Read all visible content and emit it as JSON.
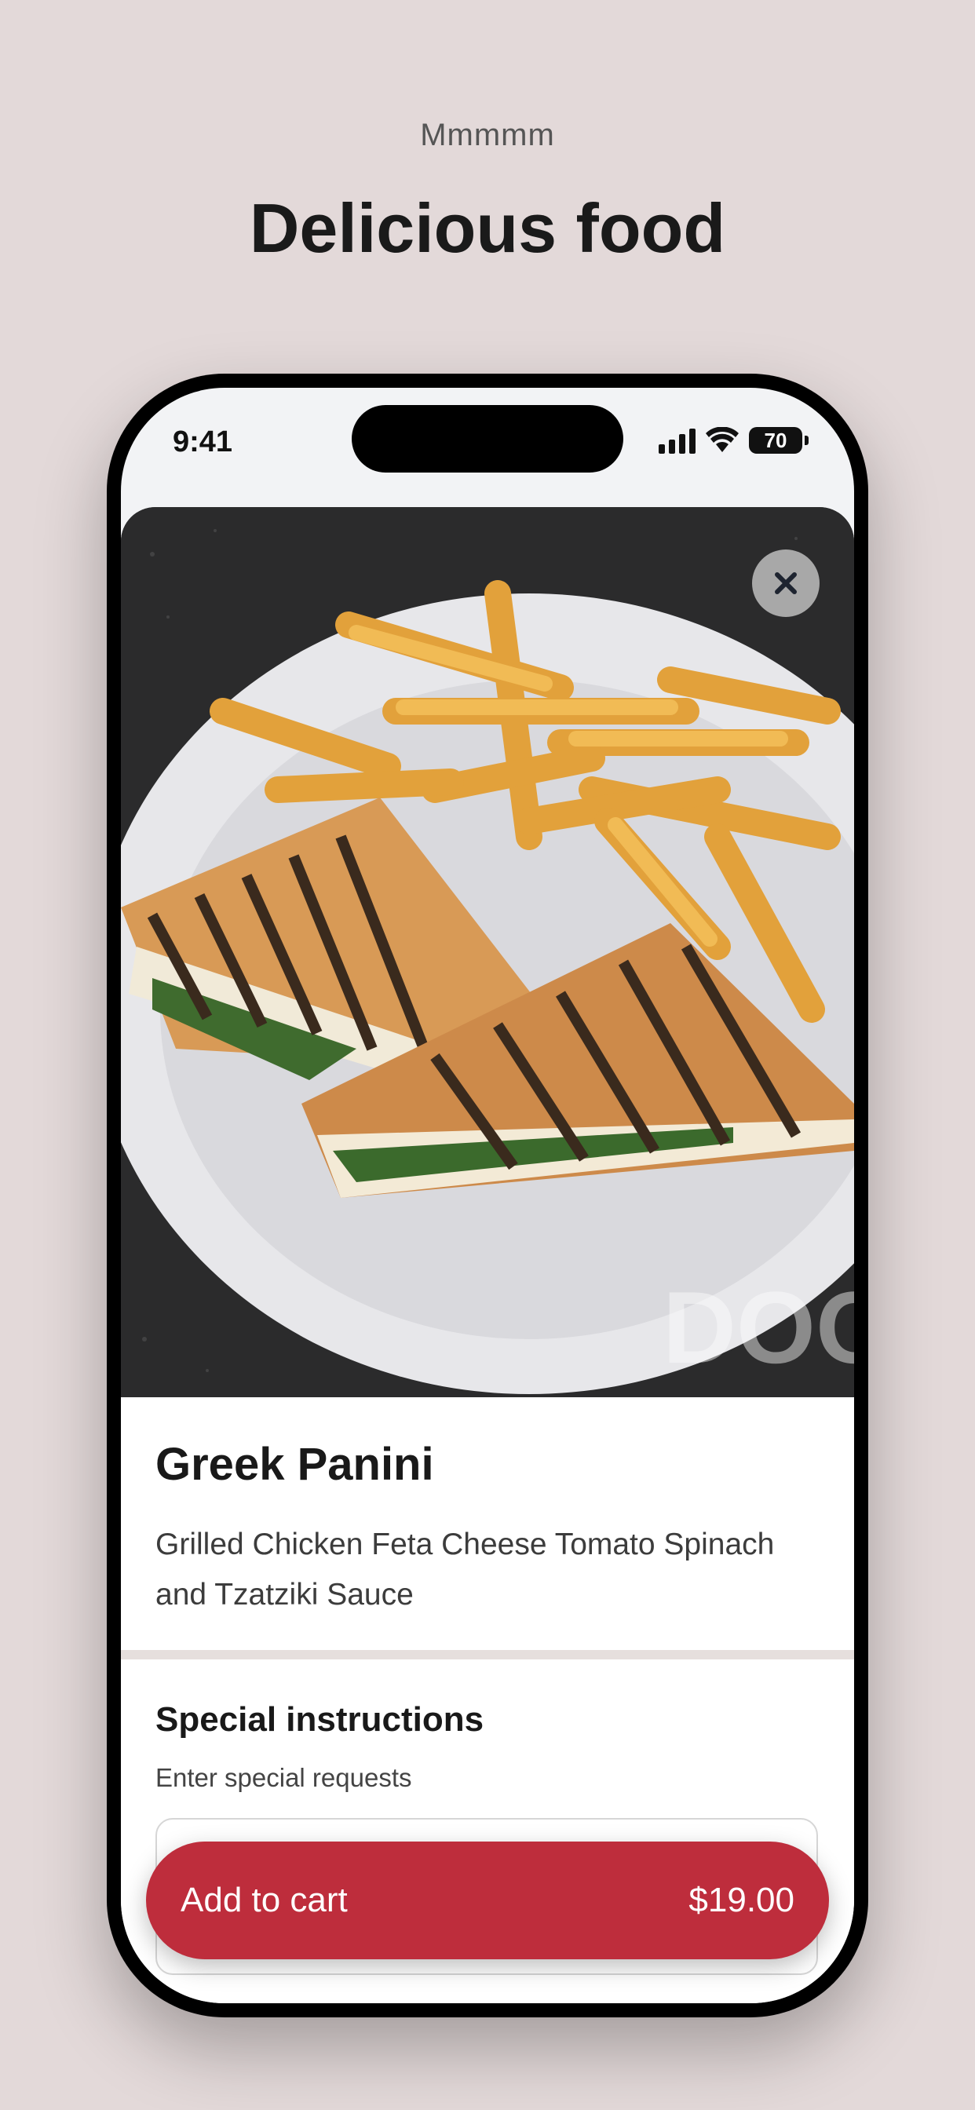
{
  "promo": {
    "eyebrow": "Mmmmm",
    "headline": "Delicious food"
  },
  "status_bar": {
    "time": "9:41",
    "battery": "70"
  },
  "item": {
    "image_icon": "food-photo",
    "close_icon": "close-icon",
    "name": "Greek Panini",
    "description": "Grilled Chicken Feta Cheese Tomato Spinach and Tzatziki Sauce",
    "watermark": "DOO"
  },
  "special_instructions": {
    "title": "Special instructions",
    "subtitle": "Enter special requests",
    "value": ""
  },
  "cart": {
    "label": "Add to cart",
    "price": "$19.00"
  },
  "colors": {
    "background": "#e3d9d9",
    "accent": "#be2d3c"
  }
}
